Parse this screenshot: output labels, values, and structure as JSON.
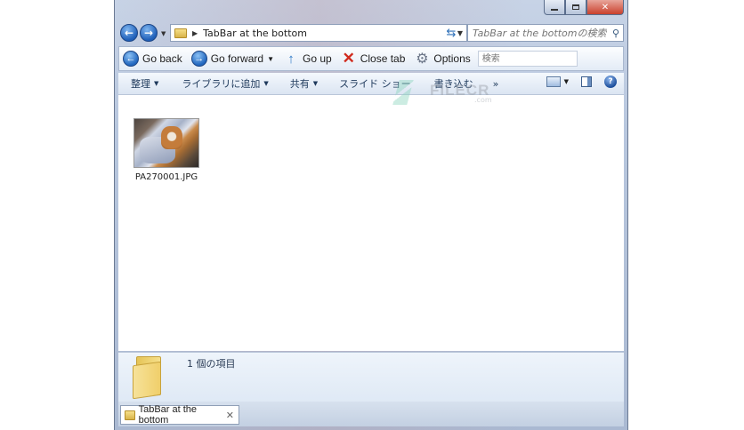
{
  "window": {
    "caption_buttons": {
      "minimize": "minimize-icon",
      "maximize": "maximize-icon",
      "close": "close-icon"
    }
  },
  "address": {
    "path": "TabBar at the bottom",
    "search_placeholder": "TabBar at the bottomの検索"
  },
  "toolbar": {
    "go_back": "Go back",
    "go_forward": "Go forward",
    "go_up": "Go up",
    "close_tab": "Close tab",
    "options": "Options",
    "search_placeholder": "検索"
  },
  "commands": {
    "organize": "整理",
    "add_to_library": "ライブラリに追加",
    "share": "共有",
    "slideshow": "スライド ショー",
    "burn": "書き込む",
    "more": "»"
  },
  "files": [
    {
      "name": "PA270001.JPG",
      "type": "jpg-thumbnail"
    }
  ],
  "details": {
    "count_text": "1 個の項目"
  },
  "tabs": [
    {
      "label": "TabBar at the bottom",
      "close": "✕"
    }
  ],
  "watermark": {
    "text": "FILECR",
    "sub": ".com"
  },
  "colors": {
    "accent": "#2166be",
    "close_red": "#c9402c"
  }
}
